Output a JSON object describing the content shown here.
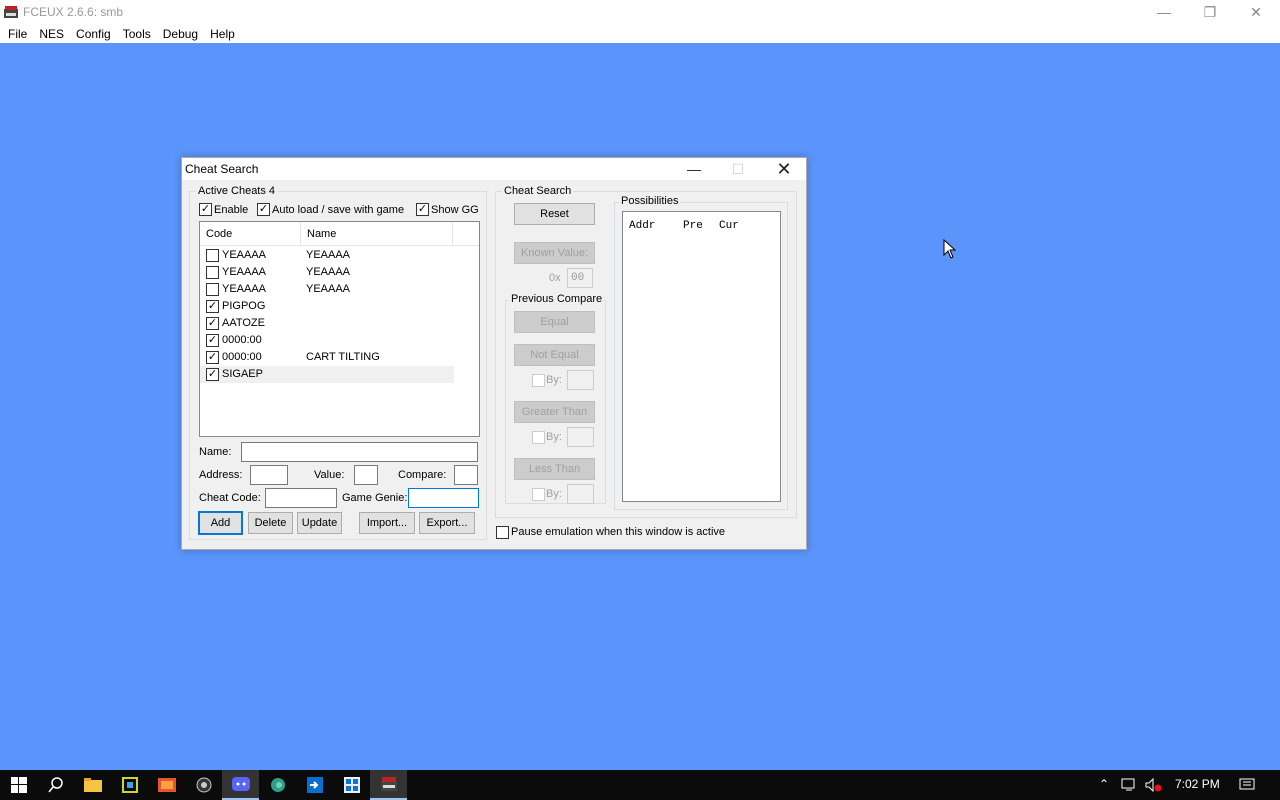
{
  "app": {
    "title": "FCEUX 2.6.6: smb",
    "menu": [
      "File",
      "NES",
      "Config",
      "Tools",
      "Debug",
      "Help"
    ]
  },
  "dialog": {
    "title": "Cheat Search",
    "active_cheats_label": "Active Cheats 4",
    "enable_label": "Enable",
    "autoload_label": "Auto load / save with game",
    "showgg_label": "Show GG",
    "columns": [
      "Code",
      "Name"
    ],
    "cheats": [
      {
        "code": "YEAAAA",
        "name": "YEAAAA",
        "checked": false
      },
      {
        "code": "YEAAAA",
        "name": "YEAAAA",
        "checked": false
      },
      {
        "code": "YEAAAA",
        "name": "YEAAAA",
        "checked": false
      },
      {
        "code": "PIGPOG",
        "name": "",
        "checked": true
      },
      {
        "code": "AATOZE",
        "name": "",
        "checked": true
      },
      {
        "code": "0000:00",
        "name": "",
        "checked": true
      },
      {
        "code": "0000:00",
        "name": "CART TILTING",
        "checked": true
      },
      {
        "code": "SIGAEP",
        "name": "",
        "checked": true
      }
    ],
    "name_label": "Name:",
    "address_label": "Address:",
    "value_label": "Value:",
    "compare_label": "Compare:",
    "cheat_code_label": "Cheat Code:",
    "game_genie_label": "Game Genie:",
    "add": "Add",
    "delete": "Delete",
    "update": "Update",
    "import": "Import...",
    "export": "Export...",
    "search_group": "Cheat Search",
    "reset": "Reset",
    "known_value": "Known Value:",
    "hex_prefix": "0x",
    "known_value_input": "00",
    "previous_compare": "Previous Compare",
    "equal": "Equal",
    "not_equal": "Not Equal",
    "by": "By:",
    "greater_than": "Greater Than",
    "less_than": "Less Than",
    "possibilities": "Possibilities",
    "poss_cols": [
      "Addr",
      "Pre",
      "Cur"
    ],
    "pause_label": "Pause emulation when this window is active"
  },
  "taskbar": {
    "time": "7:02 PM",
    "pinned": [
      "start-icon",
      "search-icon",
      "file-explorer-icon",
      "app-icon",
      "firefox-icon",
      "obs-icon",
      "discord-icon",
      "edge-icon",
      "remote-icon",
      "store-icon",
      "fceux-icon"
    ]
  }
}
